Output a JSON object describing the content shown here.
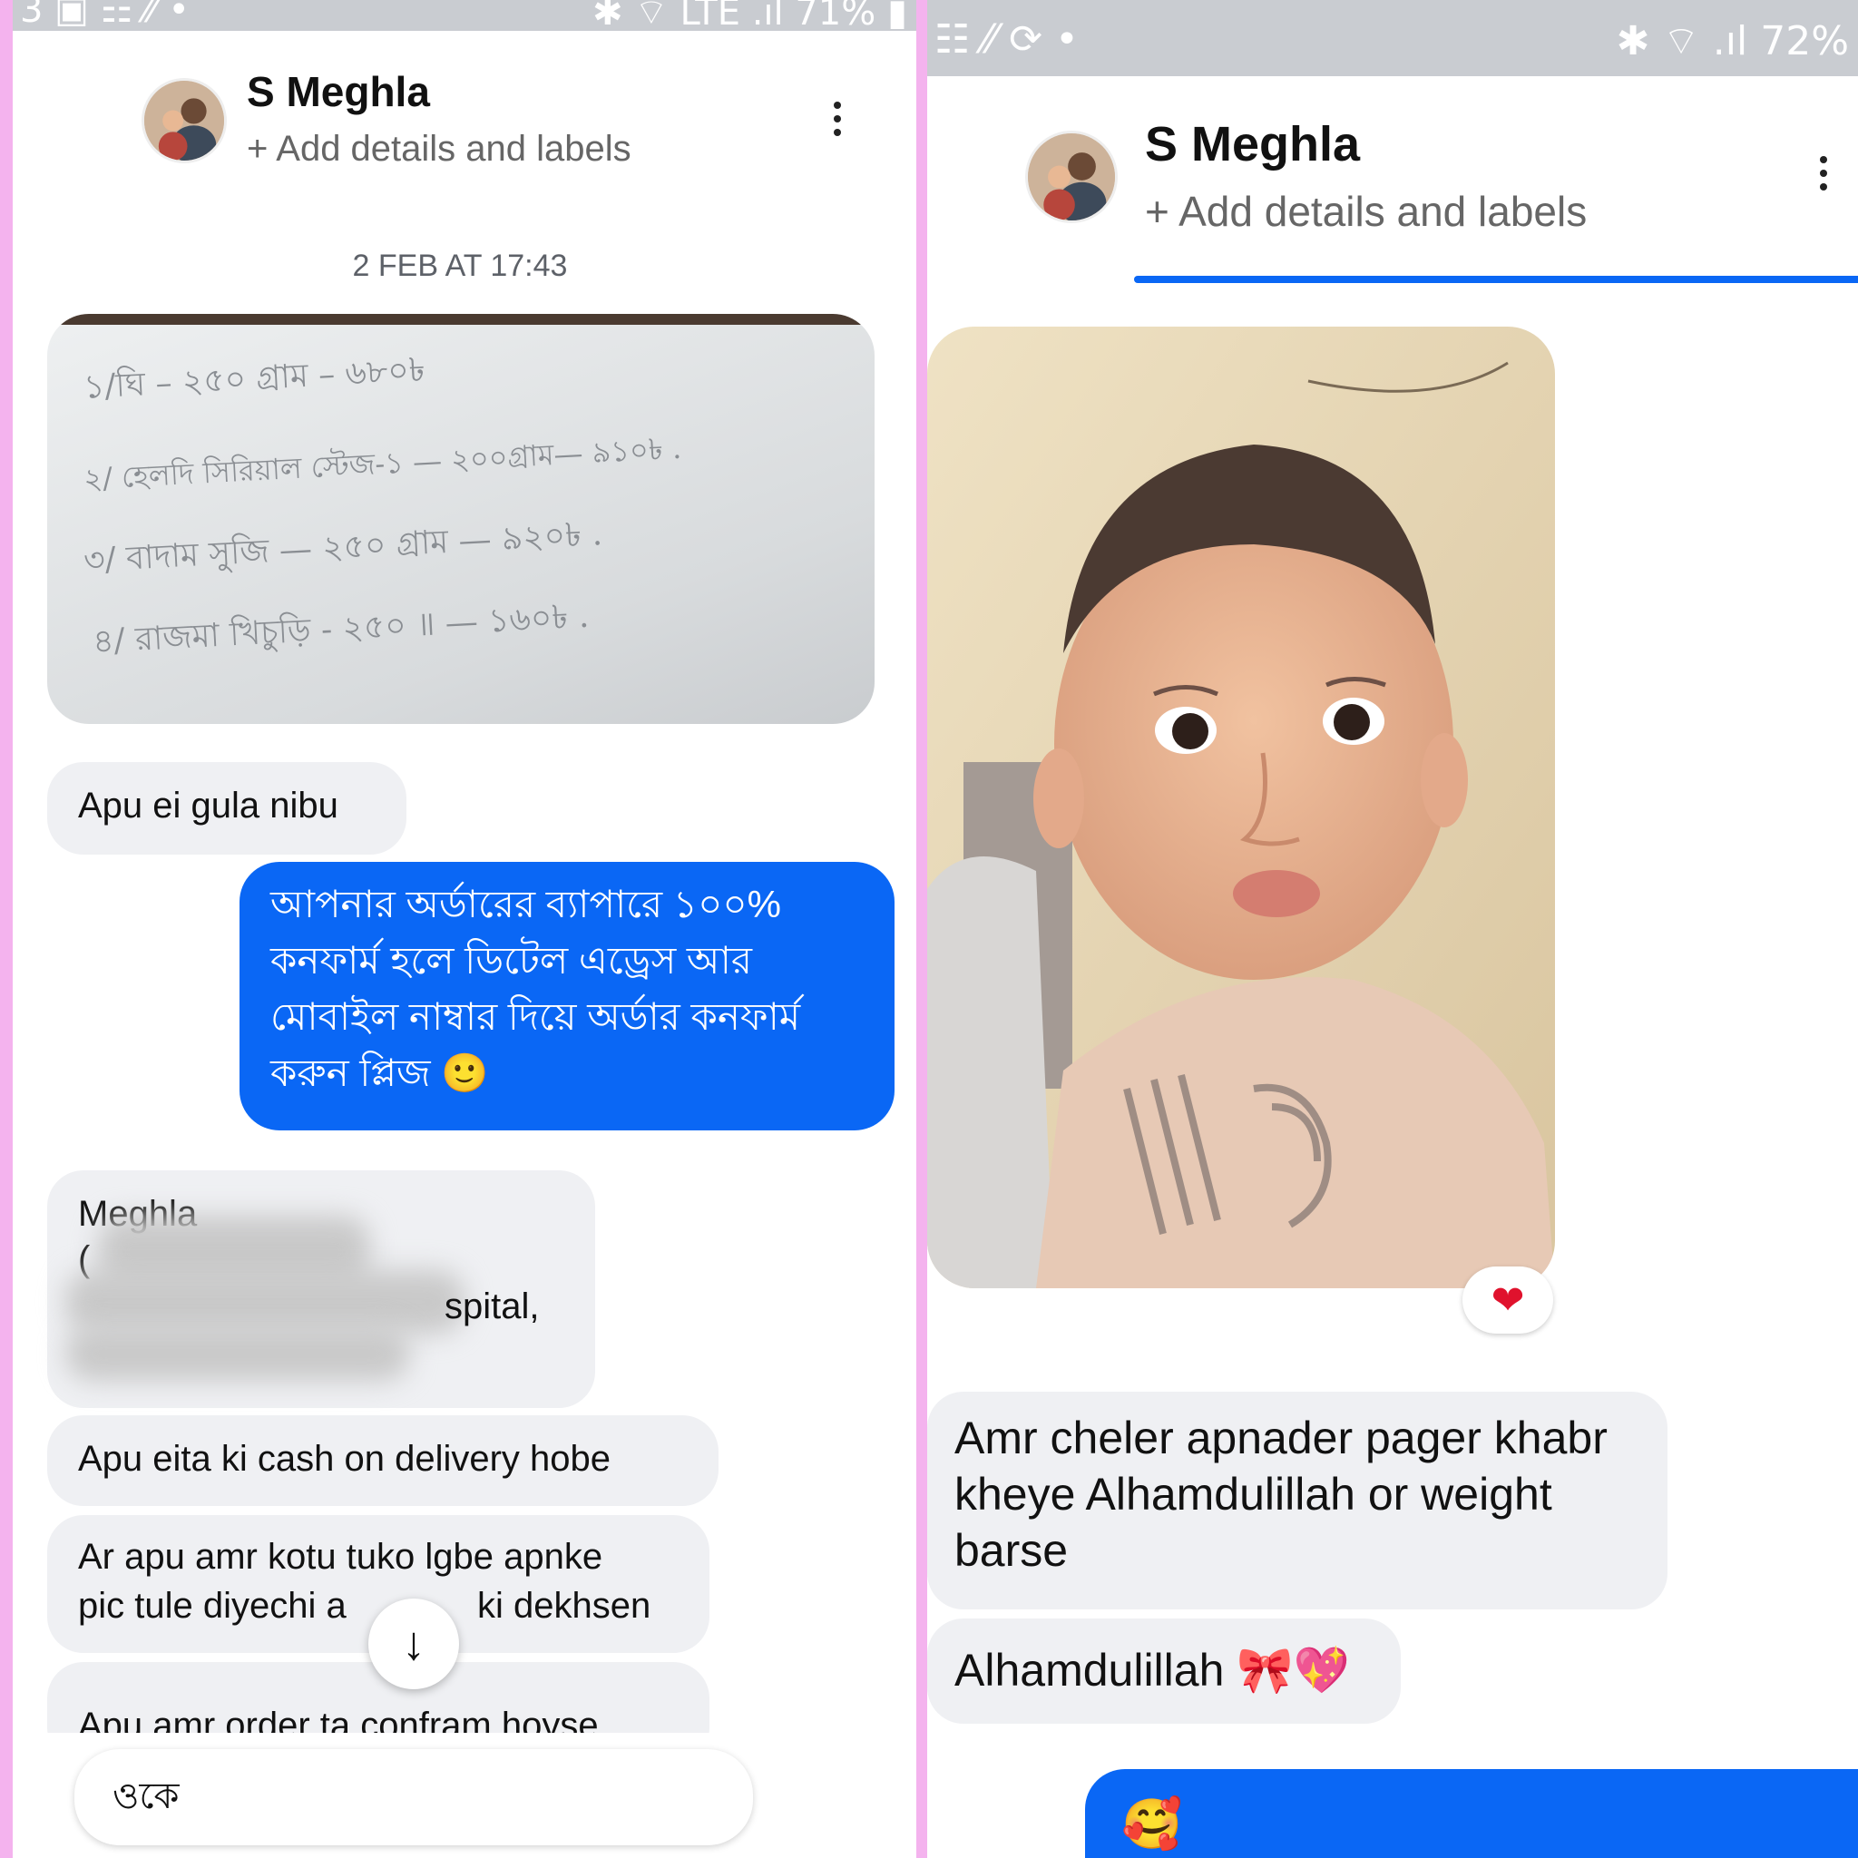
{
  "left": {
    "status": {
      "left": "3 ▣ ☷ ⁄⁄ •",
      "right": "✱ ⌔ LTE .ıl 71% ▮"
    },
    "header": {
      "name": "S Meghla",
      "sub": "+ Add details and labels"
    },
    "date": "2 FEB AT 17:43",
    "note_lines": [
      "১/ঘি – ২৫০ গ্রাম – ৬৮০৳",
      "২/ হেলদি সিরিয়াল স্টেজ-১ — ২০০গ্রাম— ৯১০৳ .",
      "৩/ বাদাম সুজি — ২৫০ গ্রাম — ৯২০৳ .",
      "৪/ রাজমা খিচুড়ি - ২৫০ ॥ — ১৬০৳ ."
    ],
    "messages": {
      "m1": "Apu ei gula nibu",
      "out1": "আপনার অর্ডারের ব্যাপারে ১০০% কনফার্ম হলে ডিটেল এড্রেস আর মোবাইল নাম্বার দিয়ে অর্ডার কনফার্ম করুন প্লিজ 🙂",
      "addr_name": "Meghla",
      "addr_c": "(",
      "addr_tail": "spital,",
      "m3": "Apu eita ki cash on delivery hobe",
      "m4_l1": "Ar apu amr kotu tuko lgbe apnke",
      "m4_l2a": "pic tule diyechi a",
      "m4_l2b": "ki dekhsen",
      "m5": "Apu amr order ta confram hoyse"
    },
    "composer_text": "ওকে",
    "scroll_icon": "↓"
  },
  "right": {
    "status": {
      "left": "☷ ⁄⁄ ⟳ •",
      "right": "✱ ⌔ .ıl 72%"
    },
    "header": {
      "name": "S Meghla",
      "sub": "+ Add details and labels"
    },
    "reaction": "❤",
    "messages": {
      "m1": "Amr cheler apnader pager khabr kheye Alhamdulillah or weight barse",
      "m2": "Alhamdulillah 🎀💖",
      "out1": "🥰"
    }
  },
  "colors": {
    "accent": "#0a67f5",
    "incoming": "#eff0f3",
    "divider": "#f4b3ee"
  }
}
